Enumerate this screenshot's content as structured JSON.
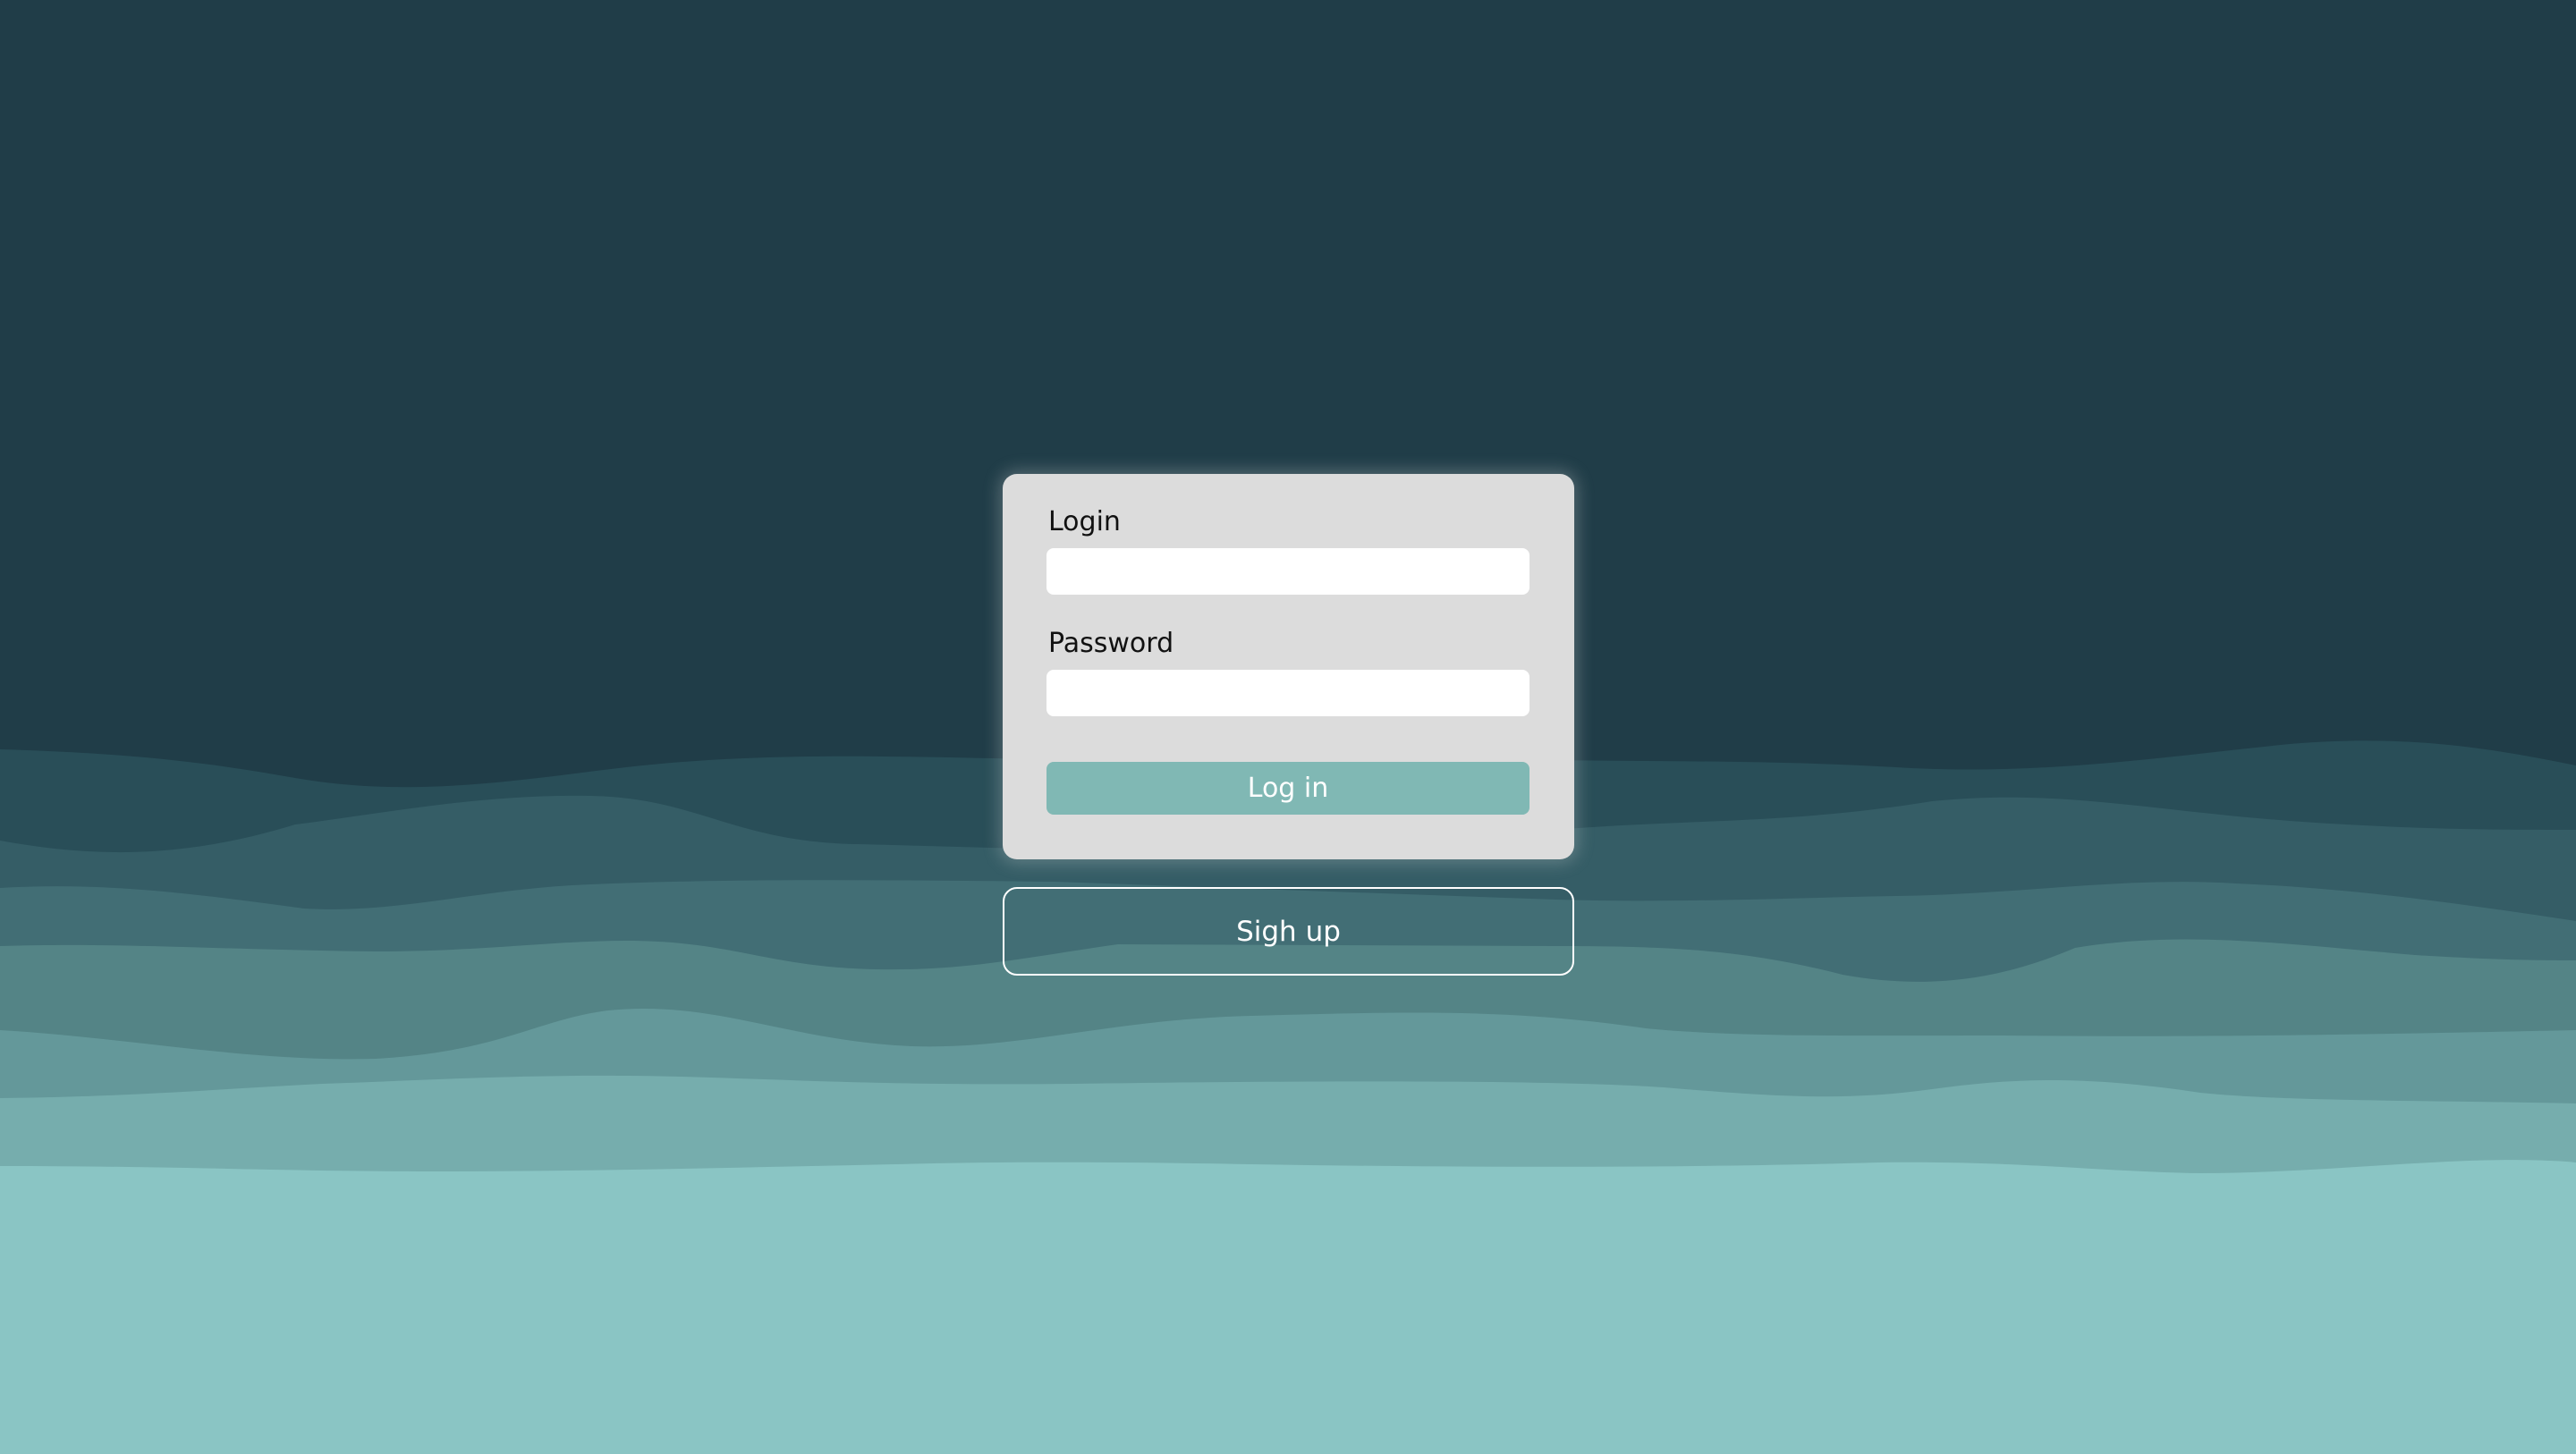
{
  "login_form": {
    "login_label": "Login",
    "login_value": "",
    "password_label": "Password",
    "password_value": "",
    "login_button_label": "Log in"
  },
  "signup_button_label": "Sigh up",
  "colors": {
    "background_top": "#203d48",
    "wave_layers": [
      "#294e58",
      "#355d66",
      "#426e75",
      "#548486",
      "#64989a",
      "#76adad",
      "#8ac5c4"
    ],
    "card_background": "#dcdcdc",
    "login_button": "#80b8b4",
    "signup_border": "#ffffff"
  }
}
